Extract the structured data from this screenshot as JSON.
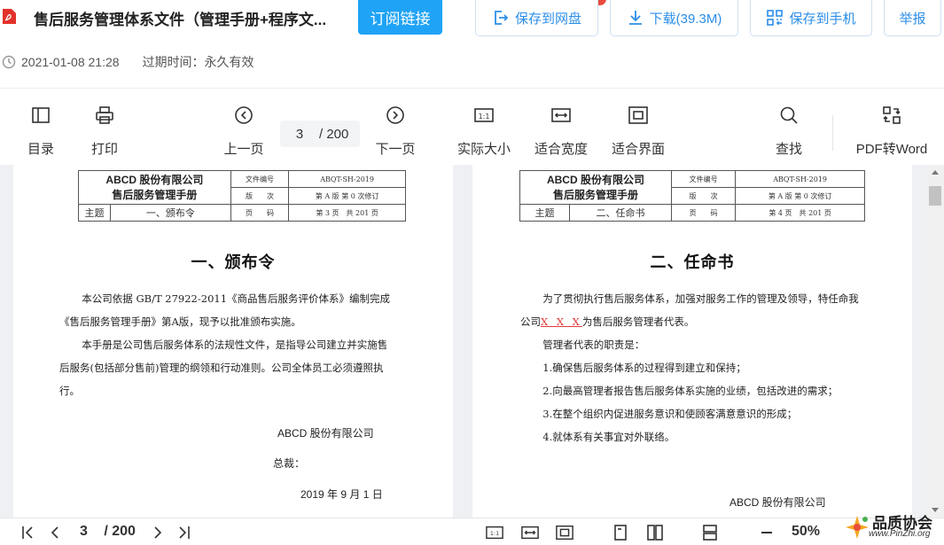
{
  "header": {
    "title": "售后服务管理体系文件（管理手册+程序文...",
    "subscribe_label": "订阅链接",
    "save_cloud_label": "保存到网盘",
    "download_label": "下载(39.3M)",
    "save_phone_label": "保存到手机",
    "report_label": "举报",
    "datetime": "2021-01-08 21:28",
    "expiry": "过期时间：永久有效",
    "accent_color": "#1fa3f6"
  },
  "toolbar": {
    "toc_label": "目录",
    "print_label": "打印",
    "prev_label": "上一页",
    "current_page": "3",
    "total_pages": "/ 200",
    "next_label": "下一页",
    "actual_size_label": "实际大小",
    "fit_width_label": "适合宽度",
    "fit_screen_label": "适合界面",
    "search_label": "查找",
    "convert_label": "PDF转Word",
    "actual_size_glyph": "1:1"
  },
  "page1": {
    "company": "ABCD 股份有限公司",
    "manual": "售后服务管理手册",
    "topic_label": "主题",
    "topic": "一、颁布令",
    "docno_label": "文件编号",
    "docno": "ABQT-SH-2019",
    "version_label": "版　　次",
    "version": "第 A 版 第 0 次修订",
    "page_label": "页　　码",
    "page": "第 3 页　共 201 页",
    "heading": "一、颁布令",
    "para1": "本公司依据 GB/T 27922-2011《商品售后服务评价体系》编制完成《售后服务管理手册》第A版，现予以批准颁布实施。",
    "para2": "本手册是公司售后服务体系的法规性文件，是指导公司建立并实施售后服务(包括部分售前)管理的纲领和行动准则。公司全体员工必须遵照执行。",
    "sign_company": "ABCD 股份有限公司",
    "sign_title": "总裁：",
    "sign_date": "2019 年  9 月 1 日"
  },
  "page2": {
    "company": "ABCD 股份有限公司",
    "manual": "售后服务管理手册",
    "topic_label": "主题",
    "topic": "二、任命书",
    "docno_label": "文件编号",
    "docno": "ABQT-SH-2019",
    "version_label": "版　　次",
    "version": "第 A 版 第 0 次修订",
    "page_label": "页　　码",
    "page": "第 4 页　共 201 页",
    "heading": "二、任命书",
    "para1_a": "为了贯彻执行售后服务体系，加强对服务工作的管理及领导，特任命我公司",
    "para1_x": "X X X",
    "para1_b": "为售后服务管理者代表。",
    "duties_title": "管理者代表的职责是：",
    "duty1": "1.确保售后服务体系的过程得到建立和保持；",
    "duty2": "2.向最高管理者报告售后服务体系实施的业绩，包括改进的需求；",
    "duty3": "3.在整个组织内促进服务意识和使顾客满意意识的形成；",
    "duty4": "4.就体系有关事宜对外联络。",
    "sign_company": "ABCD 股份有限公司"
  },
  "bottom": {
    "current_page": "3",
    "total_pages": "/ 200",
    "zoom": "50%",
    "glyph_1to1": "1:1"
  },
  "watermark": {
    "name": "品质协会",
    "url": "www.PinZhi.org"
  }
}
